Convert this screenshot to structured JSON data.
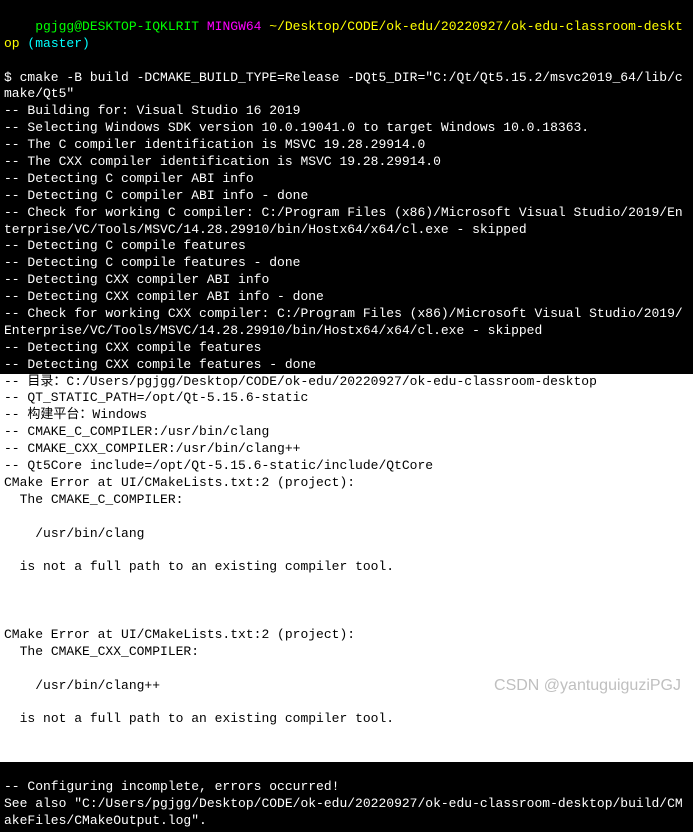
{
  "prompt": {
    "user": "pgjgg@DESKTOP-IQKLRIT",
    "shell": "MINGW64",
    "path": "~/Desktop/CODE/ok-edu/20220927/ok-edu-classroom-desktop",
    "branch": "(master)"
  },
  "command": "$ cmake -B build -DCMAKE_BUILD_TYPE=Release -DQt5_DIR=\"C:/Qt/Qt5.15.2/msvc2019_64/lib/cmake/Qt5\"",
  "output": {
    "l1": "-- Building for: Visual Studio 16 2019",
    "l2": "-- Selecting Windows SDK version 10.0.19041.0 to target Windows 10.0.18363.",
    "l3": "-- The C compiler identification is MSVC 19.28.29914.0",
    "l4": "-- The CXX compiler identification is MSVC 19.28.29914.0",
    "l5": "-- Detecting C compiler ABI info",
    "l6": "-- Detecting C compiler ABI info - done",
    "l7": "-- Check for working C compiler: C:/Program Files (x86)/Microsoft Visual Studio/2019/Enterprise/VC/Tools/MSVC/14.28.29910/bin/Hostx64/x64/cl.exe - skipped",
    "l8": "-- Detecting C compile features",
    "l9": "-- Detecting C compile features - done",
    "l10": "-- Detecting CXX compiler ABI info",
    "l11": "-- Detecting CXX compiler ABI info - done",
    "l12": "-- Check for working CXX compiler: C:/Program Files (x86)/Microsoft Visual Studio/2019/Enterprise/VC/Tools/MSVC/14.28.29910/bin/Hostx64/x64/cl.exe - skipped",
    "l13": "-- Detecting CXX compile features",
    "l14": "-- Detecting CXX compile features - done"
  },
  "highlighted": {
    "l1": "-- 目录：C:/Users/pgjgg/Desktop/CODE/ok-edu/20220927/ok-edu-classroom-desktop",
    "l2": "-- QT_STATIC_PATH=/opt/Qt-5.15.6-static",
    "l3": "-- 构建平台：Windows",
    "l4": "-- CMAKE_C_COMPILER:/usr/bin/clang",
    "l5": "-- CMAKE_CXX_COMPILER:/usr/bin/clang++",
    "l6": "-- Qt5Core include=/opt/Qt-5.15.6-static/include/QtCore",
    "err1_head": "CMake Error at UI/CMakeLists.txt:2 (project):",
    "err1_body1": "  The CMAKE_C_COMPILER:",
    "err1_body2": "    /usr/bin/clang",
    "err1_body3": "  is not a full path to an existing compiler tool.",
    "err2_head": "CMake Error at UI/CMakeLists.txt:2 (project):",
    "err2_body1": "  The CMAKE_CXX_COMPILER:",
    "err2_body2": "    /usr/bin/clang++",
    "err2_body3": "  is not a full path to an existing compiler tool."
  },
  "footer": {
    "l1": "-- Configuring incomplete, errors occurred!",
    "l2": "See also \"C:/Users/pgjgg/Desktop/CODE/ok-edu/20220927/ok-edu-classroom-desktop/build/CMakeFiles/CMakeOutput.log\"."
  },
  "watermark": "CSDN @yantuguiguziPGJ"
}
